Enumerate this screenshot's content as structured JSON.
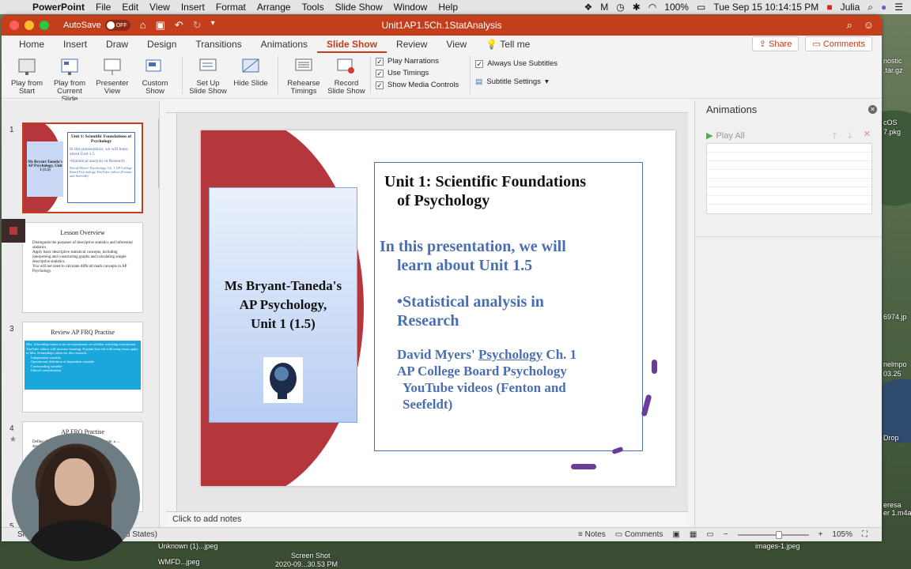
{
  "menubar": {
    "app": "PowerPoint",
    "items": [
      "File",
      "Edit",
      "View",
      "Insert",
      "Format",
      "Arrange",
      "Tools",
      "Slide Show",
      "Window",
      "Help"
    ],
    "battery": "100%",
    "clock": "Tue Sep 15  10:14:15 PM",
    "user": "Julia"
  },
  "titlebar": {
    "autosave_label": "AutoSave",
    "autosave_state": "OFF",
    "document_title": "Unit1AP1.5Ch.1StatAnalysis"
  },
  "tabs": {
    "items": [
      "Home",
      "Insert",
      "Draw",
      "Design",
      "Transitions",
      "Animations",
      "Slide Show",
      "Review",
      "View"
    ],
    "active": "Slide Show",
    "tell_me": "Tell me",
    "share": "Share",
    "comments": "Comments"
  },
  "ribbon": {
    "play_from_start": "Play from Start",
    "play_from_current": "Play from Current Slide",
    "presenter_view": "Presenter View",
    "custom_show": "Custom Show",
    "set_up": "Set Up Slide Show",
    "hide_slide": "Hide Slide",
    "rehearse": "Rehearse Timings",
    "record": "Record Slide Show",
    "play_narrations": "Play Narrations",
    "use_timings": "Use Timings",
    "show_media_controls": "Show Media Controls",
    "always_use_subtitles": "Always Use Subtitles",
    "subtitle_settings": "Subtitle Settings"
  },
  "thumbnails": [
    {
      "number": "1",
      "title": "Unit 1: Scientific Foundations of Psychology",
      "lines": [
        "In this presentation, we will learn about Unit 1.5",
        "•Statistical analysis in Research",
        "David Myers' Psychology Ch. 1 AP College Board Psychology YouTube videos (Fenton and Seefeldt)"
      ],
      "card": "Ms Bryant-Taneda's AP Psychology, Unit 1 (1.5)"
    },
    {
      "number": "2",
      "title": "Lesson Overview",
      "lines": [
        "Distinguish the purposes of descriptive statistics and inferential statistics.",
        "Apply basic descriptive statistical concepts, including interpreting and constructing graphs and calculating simple descriptive statistics.",
        "You will not need to calculate difficult math concepts in AP Psychology."
      ]
    },
    {
      "number": "3",
      "title": "Review AP FRQ Practise",
      "lines": [
        "Mrs. Schmidlap wants to do an experiment on whether watching educational YouTube videos will increase learning. Explain how the following terms apply to Mrs. Schmidlap's ideas for this research.",
        "Independent variable",
        "Operational definition of dependent variable",
        "Confounding variable",
        "Ethical consideration"
      ]
    },
    {
      "number": "4",
      "title": "AP FRQ Practise",
      "lines": [
        "Define: A ... variable is something that ... example, a ... dependent"
      ]
    },
    {
      "number": "5",
      "title": "",
      "lines": []
    }
  ],
  "slide": {
    "card_text": [
      "Ms Bryant-Taneda's",
      "AP Psychology,",
      "Unit 1 (1.5)"
    ],
    "title_line1": "Unit 1: Scientific Foundations",
    "title_line2": "of  Psychology",
    "intro_line1": "In this presentation, we will",
    "intro_line2": "learn about Unit 1.5",
    "bullet_line1": "•Statistical analysis in",
    "bullet_line2": "Research",
    "ref_line1_prefix": "David Myers' ",
    "ref_line1_link": "Psychology",
    "ref_line1_suffix": " Ch. 1",
    "ref_line2": "AP College Board Psychology",
    "ref_line3": "YouTube videos (Fenton and",
    "ref_line4": "Seefeldt)"
  },
  "notes": {
    "placeholder": "Click to add notes"
  },
  "animations": {
    "title": "Animations",
    "play_all": "Play All"
  },
  "statusbar": {
    "left": "Sl",
    "language": "d States)",
    "notes": "Notes",
    "comments": "Comments",
    "zoom": "105%"
  },
  "desktop": {
    "labels": [
      "nostic",
      ".tar.gz",
      "cOS",
      "7.pkg",
      "6974.jp",
      "nelmpo",
      "03.25",
      "Drop",
      "eresa",
      "er 1.m4a",
      "images-1.jpeg",
      "Screen Shot",
      "2020-09...30.53 PM",
      "Unknown (1)...jpeg",
      "WMFD...jpeg"
    ]
  },
  "colors": {
    "accent": "#c43e1c",
    "slide_blue": "#4a6fb0",
    "slide_red": "#b5373b"
  }
}
